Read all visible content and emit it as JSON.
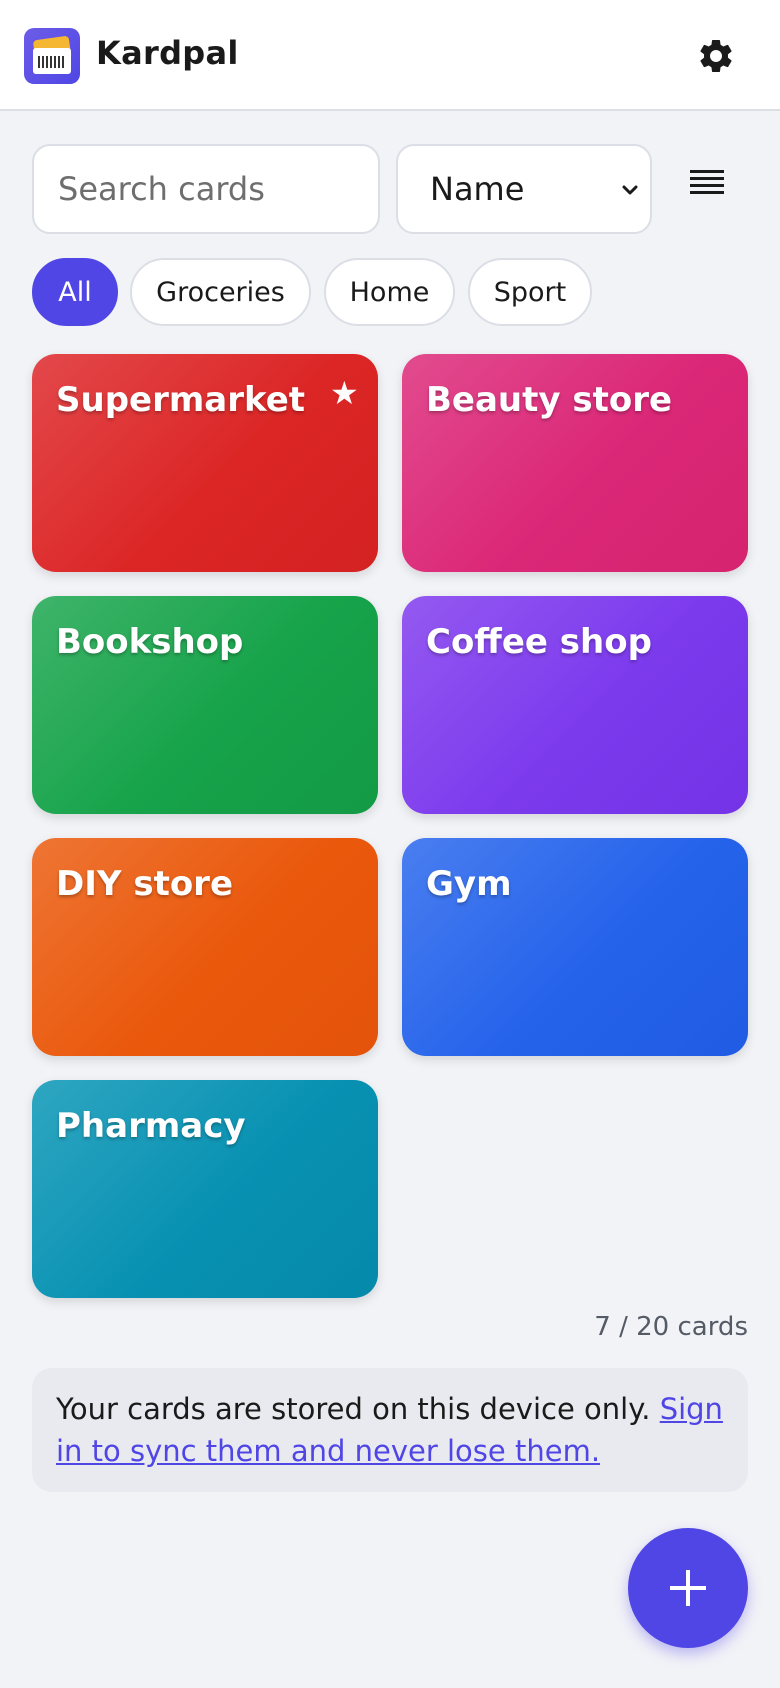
{
  "header": {
    "title": "Kardpal",
    "logo_icon": "barcode-card-icon",
    "settings_icon": "gear-icon"
  },
  "search": {
    "placeholder": "Search cards",
    "value": ""
  },
  "sort": {
    "selected": "Name",
    "icon": "chevron-down-icon"
  },
  "view_toggle_icon": "list-icon",
  "filters": [
    "All",
    "Groceries",
    "Home",
    "Sport"
  ],
  "active_filter": "All",
  "cards": [
    {
      "name": "Supermarket",
      "favorite": true,
      "color": "#dc2626"
    },
    {
      "name": "Beauty store",
      "favorite": false,
      "color": "#db2777"
    },
    {
      "name": "Bookshop",
      "favorite": false,
      "color": "#16a34a"
    },
    {
      "name": "Coffee shop",
      "favorite": false,
      "color": "#7c3aed"
    },
    {
      "name": "DIY store",
      "favorite": false,
      "color": "#ea580c"
    },
    {
      "name": "Gym",
      "favorite": false,
      "color": "#2563eb"
    },
    {
      "name": "Pharmacy",
      "favorite": false,
      "color": "#0891b2"
    }
  ],
  "count_text": "7 / 20 cards",
  "notice": {
    "text": "Your cards are stored on this device only.",
    "link": "Sign in to sync them and never lose them."
  },
  "fab_icon": "plus-icon",
  "colors": {
    "accent": "#4f46e5",
    "background": "#f2f3f7"
  }
}
